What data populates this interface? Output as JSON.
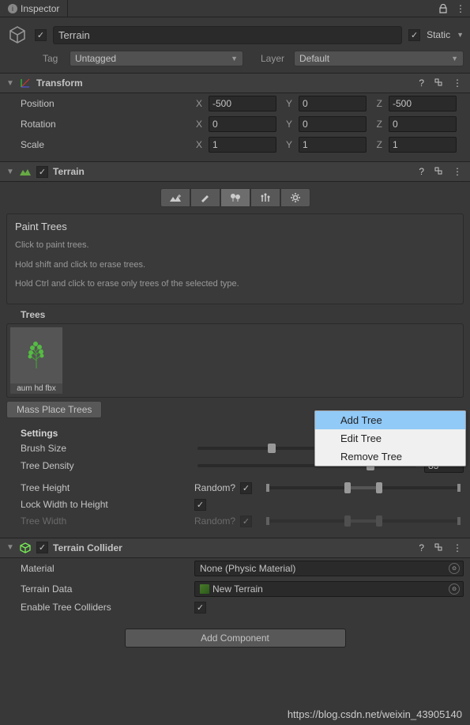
{
  "tab": {
    "title": "Inspector"
  },
  "object": {
    "name": "Terrain",
    "active": true,
    "static": true,
    "static_label": "Static",
    "tag_label": "Tag",
    "tag_value": "Untagged",
    "layer_label": "Layer",
    "layer_value": "Default"
  },
  "transform": {
    "title": "Transform",
    "position": {
      "label": "Position",
      "x": "-500",
      "y": "0",
      "z": "-500"
    },
    "rotation": {
      "label": "Rotation",
      "x": "0",
      "y": "0",
      "z": "0"
    },
    "scale": {
      "label": "Scale",
      "x": "1",
      "y": "1",
      "z": "1"
    },
    "axes": {
      "x": "X",
      "y": "Y",
      "z": "Z"
    }
  },
  "terrain": {
    "title": "Terrain",
    "enabled": true,
    "info": {
      "title": "Paint Trees",
      "line1": "Click to paint trees.",
      "line2": "Hold shift and click to erase trees.",
      "line3": "Hold Ctrl and click to erase only trees of the selected type."
    },
    "trees_label": "Trees",
    "trees": [
      {
        "name": "aum hd fbx"
      }
    ],
    "mass_place_label": "Mass Place Trees",
    "settings_label": "Settings",
    "brush_size": {
      "label": "Brush Size",
      "value": "",
      "pos": 34
    },
    "tree_density": {
      "label": "Tree Density",
      "value": "83",
      "pos": 79
    },
    "tree_height": {
      "label": "Tree Height",
      "random_label": "Random?",
      "random_checked": true,
      "min": 42,
      "max": 58
    },
    "lock_width": {
      "label": "Lock Width to Height",
      "checked": true
    },
    "tree_width": {
      "label": "Tree Width",
      "random_label": "Random?",
      "random_checked": true,
      "min": 42,
      "max": 58,
      "enabled": false
    }
  },
  "terrain_collider": {
    "title": "Terrain Collider",
    "enabled": true,
    "material": {
      "label": "Material",
      "value": "None (Physic Material)"
    },
    "terrain_data": {
      "label": "Terrain Data",
      "value": "New Terrain"
    },
    "enable_tree_colliders": {
      "label": "Enable Tree Colliders",
      "checked": true
    }
  },
  "add_component_label": "Add Component",
  "context_menu": {
    "items": [
      "Add Tree",
      "Edit Tree",
      "Remove Tree"
    ],
    "highlighted": 0
  },
  "watermark": "https://blog.csdn.net/weixin_43905140"
}
